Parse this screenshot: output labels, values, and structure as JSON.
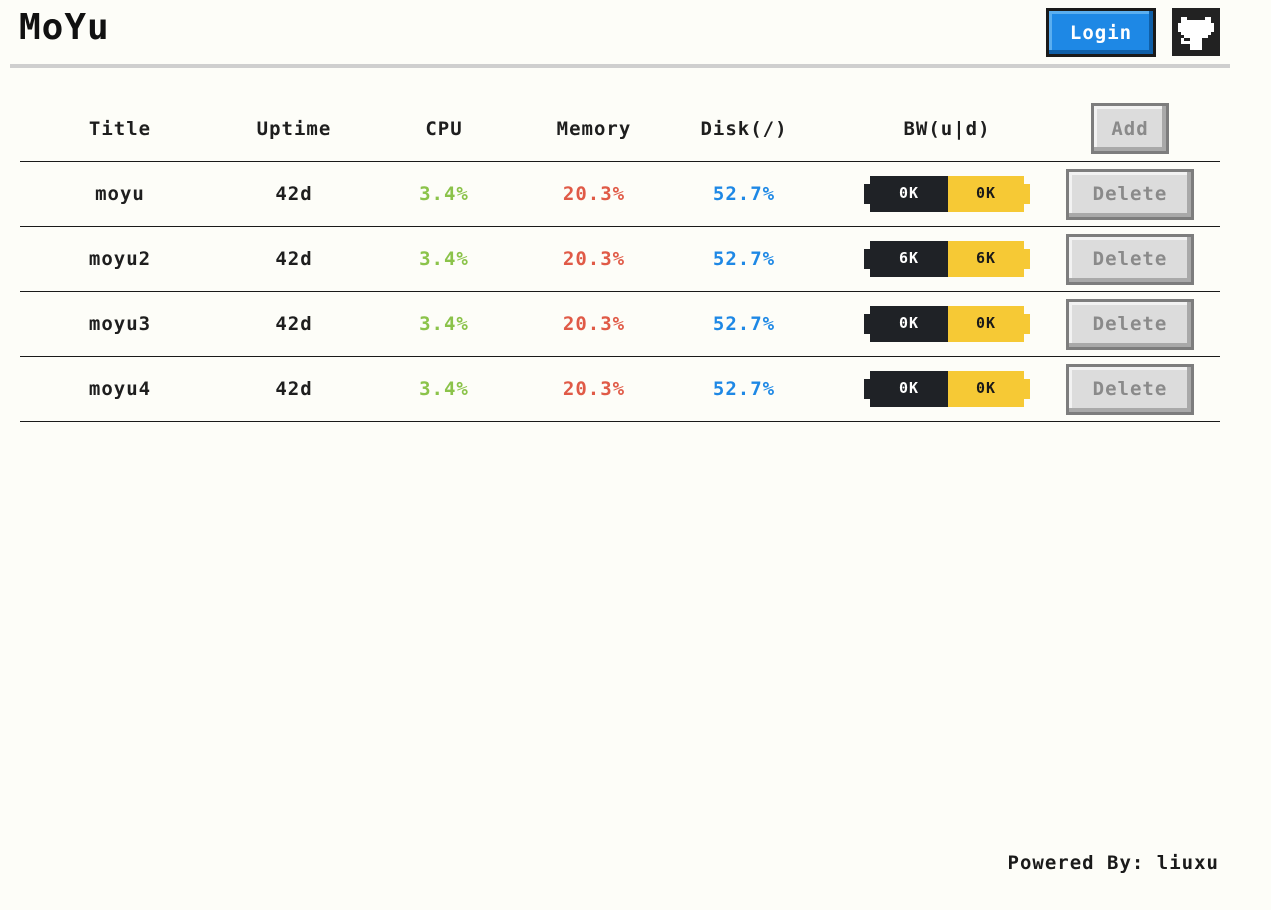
{
  "app": {
    "logo": "MoYu",
    "login_label": "Login"
  },
  "table": {
    "headers": {
      "title": "Title",
      "uptime": "Uptime",
      "cpu": "CPU",
      "memory": "Memory",
      "disk": "Disk(/)",
      "bw": "BW(u|d)"
    },
    "add_label": "Add",
    "delete_label": "Delete",
    "rows": [
      {
        "title": "moyu",
        "uptime": "42d",
        "cpu": "3.4%",
        "memory": "20.3%",
        "disk": "52.7%",
        "bw_up": "0K",
        "bw_down": "0K"
      },
      {
        "title": "moyu2",
        "uptime": "42d",
        "cpu": "3.4%",
        "memory": "20.3%",
        "disk": "52.7%",
        "bw_up": "6K",
        "bw_down": "6K"
      },
      {
        "title": "moyu3",
        "uptime": "42d",
        "cpu": "3.4%",
        "memory": "20.3%",
        "disk": "52.7%",
        "bw_up": "0K",
        "bw_down": "0K"
      },
      {
        "title": "moyu4",
        "uptime": "42d",
        "cpu": "3.4%",
        "memory": "20.3%",
        "disk": "52.7%",
        "bw_up": "0K",
        "bw_down": "0K"
      }
    ]
  },
  "footer": {
    "text": "Powered By: liuxu"
  },
  "colors": {
    "background": "#fdfdf8",
    "cpu": "#8bc34a",
    "memory": "#e05a47",
    "disk": "#1e88e5",
    "login": "#1e88e5",
    "bw_up_bg": "#1f2226",
    "bw_down_bg": "#f6c935"
  },
  "icons": {
    "github": "github-cat-icon"
  }
}
